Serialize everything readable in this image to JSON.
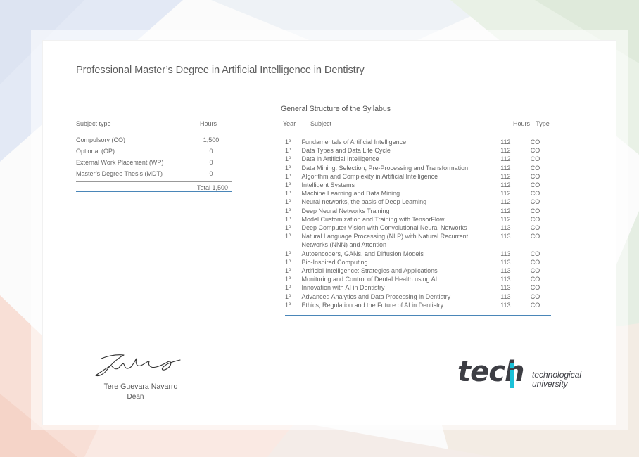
{
  "document": {
    "title": "Professional Master’s Degree in Artificial Intelligence in Dentistry"
  },
  "summary": {
    "headers": {
      "type": "Subject type",
      "hours": "Hours"
    },
    "rows": [
      {
        "type": "Compulsory (CO)",
        "hours": "1,500"
      },
      {
        "type": "Optional (OP)",
        "hours": "0"
      },
      {
        "type": "External Work Placement (WP)",
        "hours": "0"
      },
      {
        "type": "Master’s Degree Thesis (MDT)",
        "hours": "0"
      }
    ],
    "total": "Total 1,500"
  },
  "syllabus": {
    "title": "General Structure of the Syllabus",
    "headers": {
      "year": "Year",
      "subject": "Subject",
      "hours": "Hours",
      "type": "Type"
    },
    "rows": [
      {
        "year": "1º",
        "subject": "Fundamentals of Artificial Intelligence",
        "hours": "112",
        "type": "CO"
      },
      {
        "year": "1º",
        "subject": "Data Types and Data Life Cycle",
        "hours": "112",
        "type": "CO"
      },
      {
        "year": "1º",
        "subject": "Data in Artificial Intelligence",
        "hours": "112",
        "type": "CO"
      },
      {
        "year": "1º",
        "subject": "Data Mining. Selection, Pre-Processing and Transformation",
        "hours": "112",
        "type": "CO"
      },
      {
        "year": "1º",
        "subject": "Algorithm and Complexity in Artificial Intelligence",
        "hours": "112",
        "type": "CO"
      },
      {
        "year": "1º",
        "subject": "Intelligent Systems",
        "hours": "112",
        "type": "CO"
      },
      {
        "year": "1º",
        "subject": "Machine Learning and Data Mining",
        "hours": "112",
        "type": "CO"
      },
      {
        "year": "1º",
        "subject": "Neural networks, the basis of Deep Learning",
        "hours": "112",
        "type": "CO"
      },
      {
        "year": "1º",
        "subject": "Deep Neural Networks Training",
        "hours": "112",
        "type": "CO"
      },
      {
        "year": "1º",
        "subject": "Model Customization and Training with TensorFlow",
        "hours": "112",
        "type": "CO"
      },
      {
        "year": "1º",
        "subject": "Deep Computer Vision with Convolutional Neural Networks",
        "hours": "113",
        "type": "CO"
      },
      {
        "year": "1º",
        "subject": "Natural Language Processing (NLP) with Natural Recurrent Networks (NNN) and Attention",
        "hours": "113",
        "type": "CO"
      },
      {
        "year": "1º",
        "subject": "Autoencoders, GANs, and Diffusion Models",
        "hours": "113",
        "type": "CO"
      },
      {
        "year": "1º",
        "subject": "Bio-Inspired Computing",
        "hours": "113",
        "type": "CO"
      },
      {
        "year": "1º",
        "subject": "Artificial Intelligence: Strategies and Applications",
        "hours": "113",
        "type": "CO"
      },
      {
        "year": "1º",
        "subject": "Monitoring and Control of Dental Health using AI",
        "hours": "113",
        "type": "CO"
      },
      {
        "year": "1º",
        "subject": "Innovation with AI in Dentistry",
        "hours": "113",
        "type": "CO"
      },
      {
        "year": "1º",
        "subject": "Advanced Analytics and Data Processing in Dentistry",
        "hours": "113",
        "type": "CO"
      },
      {
        "year": "1º",
        "subject": "Ethics, Regulation and the Future of AI in Dentistry",
        "hours": "113",
        "type": "CO"
      }
    ]
  },
  "signatory": {
    "name": "Tere Guevara Navarro",
    "role": "Dean"
  },
  "logo": {
    "wordmark": "tech",
    "tagline_line1": "technological",
    "tagline_line2": "university",
    "accent_color": "#1bc1d8",
    "text_color": "#3d3e44"
  },
  "colors": {
    "rule": "#4a86b8"
  }
}
